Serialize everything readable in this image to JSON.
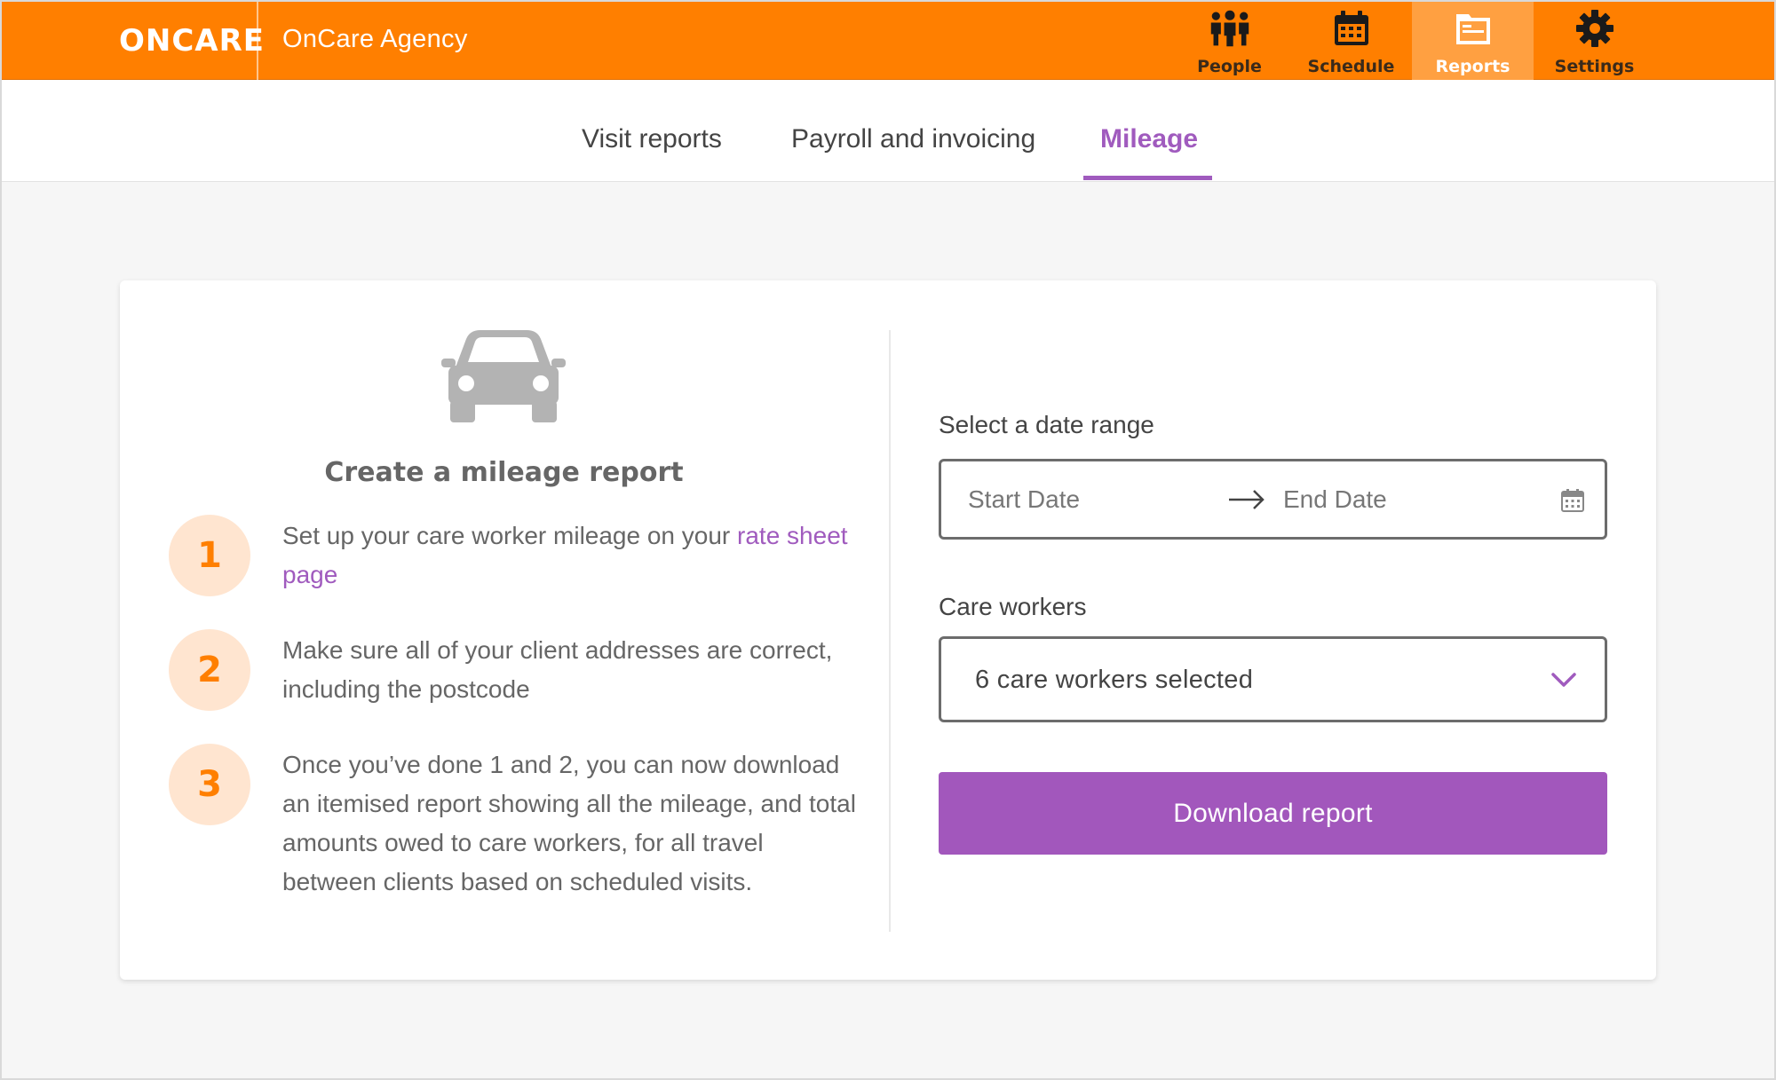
{
  "header": {
    "logo": "ONCARE",
    "agency_name": "OnCare Agency",
    "nav": [
      {
        "label": "People",
        "icon": "people-icon",
        "active": false
      },
      {
        "label": "Schedule",
        "icon": "calendar-icon",
        "active": false
      },
      {
        "label": "Reports",
        "icon": "reports-icon",
        "active": true
      },
      {
        "label": "Settings",
        "icon": "gear-icon",
        "active": false
      }
    ],
    "brand_color": "#ff7f00"
  },
  "tabs": [
    {
      "label": "Visit reports",
      "active": false
    },
    {
      "label": "Payroll and invoicing",
      "active": false
    },
    {
      "label": "Mileage",
      "active": true
    }
  ],
  "accent_color": "#a05bbe",
  "intro": {
    "icon": "car-icon",
    "title": "Create a mileage report",
    "steps": [
      {
        "number": "1",
        "text_before": "Set up your care worker mileage on your ",
        "link": "rate sheet page"
      },
      {
        "number": "2",
        "text": "Make sure all of your client addresses are correct, including the postcode"
      },
      {
        "number": "3",
        "text": "Once you’ve done 1 and 2, you can now download an itemised report showing all the mileage, and total amounts owed to care workers, for all travel between clients based on scheduled visits."
      }
    ]
  },
  "form": {
    "date_range_label": "Select a date range",
    "start_placeholder": "Start Date",
    "end_placeholder": "End Date",
    "care_workers_label": "Care workers",
    "care_workers_value": "6 care workers selected",
    "download_label": "Download report"
  }
}
